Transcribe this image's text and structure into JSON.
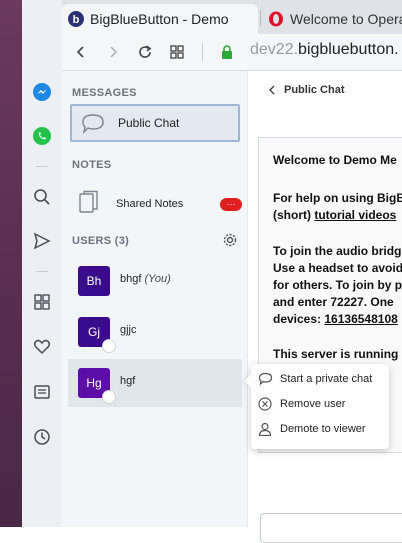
{
  "browser": {
    "tabs": [
      {
        "label": "BigBlueButton - Demo",
        "active": true
      },
      {
        "label": "Welcome to Opera",
        "active": false
      }
    ],
    "url": {
      "host_prefix": "dev22.",
      "host_main": "bigbluebutton."
    }
  },
  "sidebar": {
    "messages_title": "MESSAGES",
    "public_chat_label": "Public Chat",
    "notes_title": "NOTES",
    "shared_notes_label": "Shared Notes",
    "shared_notes_badge": "···",
    "users_title": "USERS (3)",
    "users": [
      {
        "initials": "Bh",
        "name": "bhgf",
        "suffix": "(You)",
        "color": "#3a0b8c"
      },
      {
        "initials": "Gj",
        "name": "gjjc",
        "suffix": "",
        "color": "#3a0b8c"
      },
      {
        "initials": "Hg",
        "name": "hgf",
        "suffix": "",
        "color": "#5e0ea8"
      }
    ]
  },
  "chat": {
    "header": "Public Chat",
    "welcome_lines": [
      {
        "pre": "Welcome to ",
        "strong": "Demo Me"
      },
      {
        "text": "For help on using BigB"
      },
      {
        "pre": "(short) ",
        "link": "tutorial videos"
      },
      {
        "text": "To join the audio bridg"
      },
      {
        "text": "Use a headset to avoid"
      },
      {
        "text": "for others. To join by p"
      },
      {
        "text": "and enter 72227. One"
      },
      {
        "pre": "devices: ",
        "link": "16136548108"
      },
      {
        "text": "This server is running"
      }
    ]
  },
  "context_menu": {
    "items": [
      {
        "label": "Start a private chat",
        "icon": "chat-bubble-icon"
      },
      {
        "label": "Remove user",
        "icon": "close-circle-icon"
      },
      {
        "label": "Demote to viewer",
        "icon": "user-icon"
      }
    ]
  },
  "colors": {
    "accent": "#9fb7d6",
    "badge": "#e02020",
    "avatar": "#3a0b8c"
  }
}
